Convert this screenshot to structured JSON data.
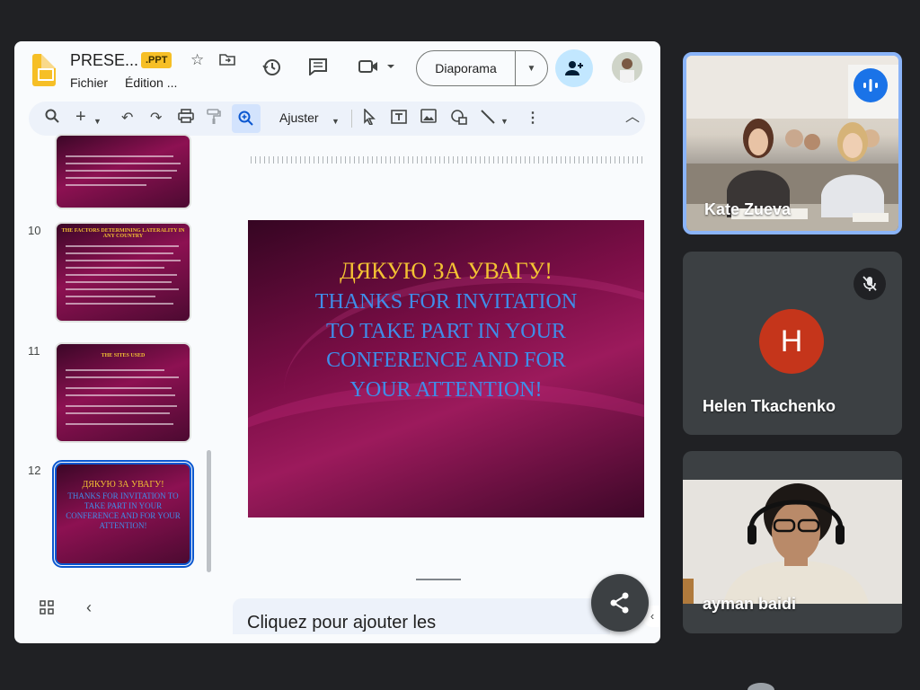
{
  "slides_app": {
    "doc_title": "PRESE...",
    "format_badge": ".PPT",
    "menu": {
      "file": "Fichier",
      "edit": "Édition ..."
    },
    "slideshow_label": "Diaporama",
    "toolbar": {
      "fit_label": "Ajuster"
    },
    "filmstrip": [
      {
        "number": "",
        "title": ""
      },
      {
        "number": "10",
        "title": "THE FACTORS DETERMINING LATERALITY IN ANY COUNTRY"
      },
      {
        "number": "11",
        "title": "THE SITES USED"
      },
      {
        "number": "12",
        "title": "ДЯКУЮ ЗА УВАГУ!",
        "body": "THANKS FOR INVITATION TO TAKE PART IN YOUR CONFERENCE AND FOR YOUR ATTENTION!"
      }
    ],
    "current_slide": {
      "title": "ДЯКУЮ ЗА УВАГУ!",
      "body_lines": [
        "THANKS FOR INVITATION",
        "TO TAKE PART IN YOUR",
        "CONFERENCE AND FOR",
        "YOUR ATTENTION!"
      ]
    },
    "notes_placeholder": "Cliquez pour ajouter les"
  },
  "meeting": {
    "participants": [
      {
        "name": "Kate Zueva",
        "speaking": true
      },
      {
        "name": "Helen Tkachenko",
        "initial": "H",
        "muted": true
      },
      {
        "name": "ayman baidi"
      }
    ]
  },
  "colors": {
    "slide_title": "#f3c133",
    "slide_body": "#3f8de9",
    "avatar_h": "#c5351b",
    "active_border": "#8ab4f8"
  }
}
